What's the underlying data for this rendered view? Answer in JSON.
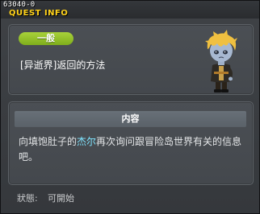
{
  "window": {
    "quest_id": "63040-0",
    "title": "QUEST INFO"
  },
  "summary": {
    "badge": "一般",
    "quest_name": "[异逝界]返回的方法",
    "npc_icon": "npc-zombie-character-icon"
  },
  "content": {
    "header": "内容",
    "text_before": "向填饱肚子的",
    "npc_name": "杰尔",
    "text_after": "再次询问跟冒险岛世界有关的信息吧。"
  },
  "status": {
    "label": "狀態:",
    "value": "可開始"
  },
  "colors": {
    "title": "#ffd21a",
    "badge": "#8fbf24",
    "npc_highlight": "#7fe4ff"
  }
}
